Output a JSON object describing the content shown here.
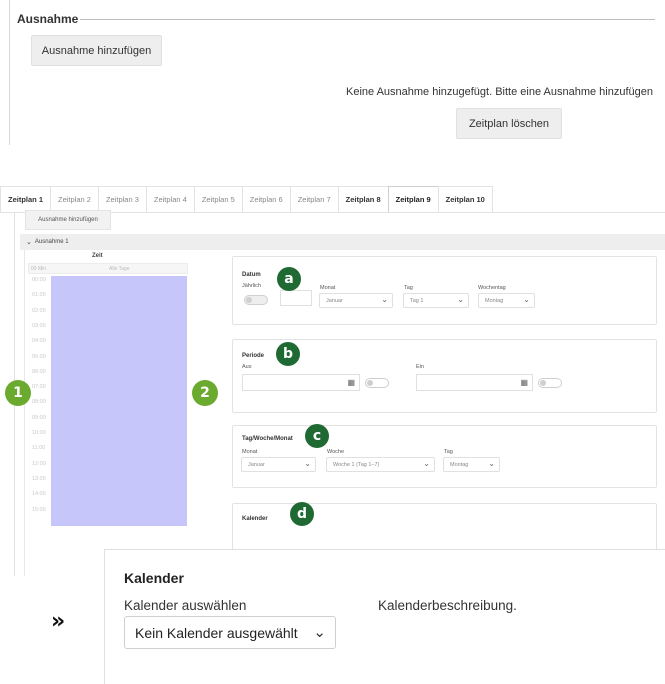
{
  "top": {
    "section_title": "Ausnahme",
    "add_exception_label": "Ausnahme hinzufügen",
    "no_exception_text": "Keine Ausnahme hinzugefügt. Bitte eine Ausnahme hinzufügen",
    "delete_schedule_label": "Zeitplan löschen"
  },
  "tabs": [
    {
      "label": "Zeitplan 1",
      "state": "bold"
    },
    {
      "label": "Zeitplan 2",
      "state": "normal"
    },
    {
      "label": "Zeitplan 3",
      "state": "normal"
    },
    {
      "label": "Zeitplan 4",
      "state": "normal"
    },
    {
      "label": "Zeitplan 5",
      "state": "normal"
    },
    {
      "label": "Zeitplan 6",
      "state": "normal"
    },
    {
      "label": "Zeitplan 7",
      "state": "normal"
    },
    {
      "label": "Zeitplan 8",
      "state": "bold"
    },
    {
      "label": "Zeitplan 9",
      "state": "active"
    },
    {
      "label": "Zeitplan 10",
      "state": "bold"
    }
  ],
  "exception": {
    "add_label": "Ausnahme hinzufügen",
    "accordion_label": "Ausnahme 1"
  },
  "time_panel": {
    "header": "Zeit",
    "col_head_left": "00 Min",
    "col_head_right": "Alle Tage",
    "times": [
      "00:00",
      "01:00",
      "02:00",
      "03:00",
      "04:00",
      "05:00",
      "06:00",
      "07:00",
      "08:00",
      "09:00",
      "10:00",
      "11:00",
      "12:00",
      "13:00",
      "14:00",
      "15:00"
    ]
  },
  "date_card": {
    "title": "Datum",
    "yearly_label": "Jährlich",
    "month_label": "Monat",
    "month_value": "Januar",
    "day_label": "Tag",
    "day_value": "Tag 1",
    "weekday_label": "Wochentag",
    "weekday_value": "Montag"
  },
  "period_card": {
    "title": "Periode",
    "off_label": "Aus",
    "on_label": "Ein"
  },
  "dwm_card": {
    "title": "Tag/Woche/Monat",
    "month_label": "Monat",
    "month_value": "Januar",
    "week_label": "Woche",
    "week_value": "Woche 1 (Tag 1–7)",
    "day_label": "Tag",
    "day_value": "Montag"
  },
  "calendar_card_small": {
    "title": "Kalender"
  },
  "badges": {
    "a": "a",
    "b": "b",
    "c": "c",
    "d": "d",
    "n1": "1",
    "n2": "2",
    "dark_color": "#1f6a33",
    "light_color": "#6aaa2e"
  },
  "zoom": {
    "arrow_glyph": "»",
    "title": "Kalender",
    "select_label": "Kalender auswählen",
    "description_label": "Kalenderbeschreibung.",
    "select_value": "Kein Kalender ausgewählt"
  },
  "accent_colors": {
    "time_fill": "#c7c6fa"
  }
}
